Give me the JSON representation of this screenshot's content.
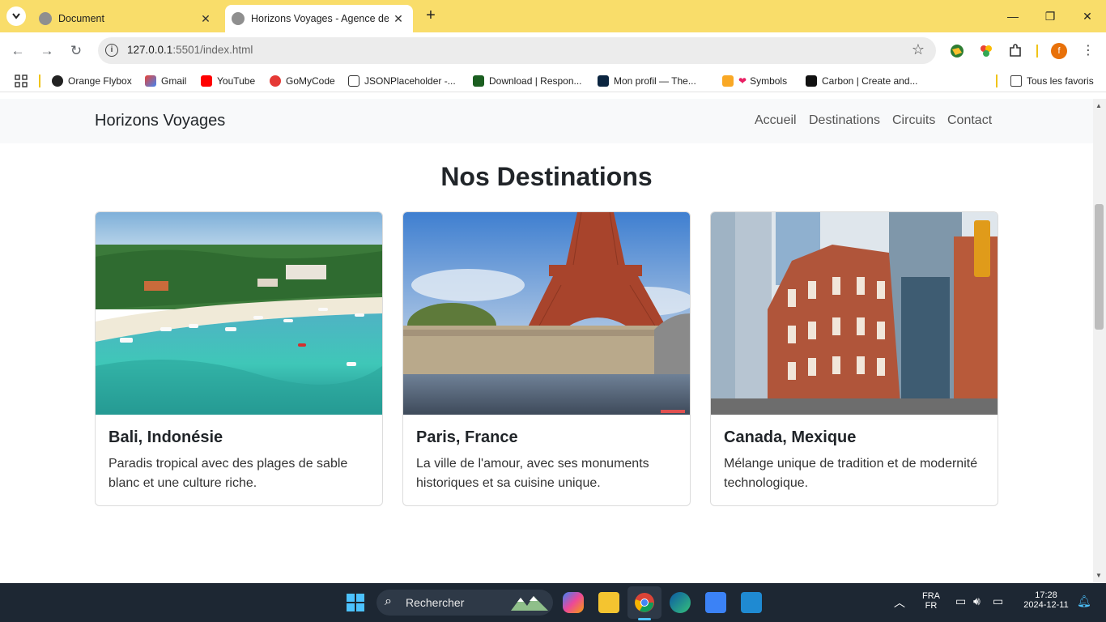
{
  "browser": {
    "tabs": [
      {
        "label": "Document",
        "active": false
      },
      {
        "label": "Horizons Voyages - Agence de",
        "active": true
      }
    ],
    "url_host": "127.0.0.1",
    "url_rest": ":5501/index.html",
    "bookmarks": [
      "Orange Flybox",
      "Gmail",
      "YouTube",
      "GoMyCode",
      "JSONPlaceholder -...",
      "Download | Respon...",
      "Mon profil — The...",
      "Symbols",
      "Carbon | Create and..."
    ],
    "all_bookmarks": "Tous les favoris",
    "profile_initial": "f"
  },
  "site": {
    "brand": "Horizons Voyages",
    "nav": [
      "Accueil",
      "Destinations",
      "Circuits",
      "Contact"
    ],
    "section_title": "Nos Destinations",
    "cards": [
      {
        "title": "Bali, Indonésie",
        "text": "Paradis tropical avec des plages de sable blanc et une culture riche.",
        "image": "bali-beach-photo"
      },
      {
        "title": "Paris, France",
        "text": "La ville de l'amour, avec ses monuments historiques et sa cuisine unique.",
        "image": "eiffel-tower-photo"
      },
      {
        "title": "Canada, Mexique",
        "text": "Mélange unique de tradition et de modernité technologique.",
        "image": "city-buildings-photo"
      }
    ]
  },
  "taskbar": {
    "search_placeholder": "Rechercher",
    "lang_top": "FRA",
    "lang_bottom": "FR",
    "time": "17:28",
    "date": "2024-12-11"
  },
  "colors": {
    "tabbar": "#f9dd6a",
    "navbar": "#f8f9fa",
    "taskbar": "#1d2733"
  }
}
